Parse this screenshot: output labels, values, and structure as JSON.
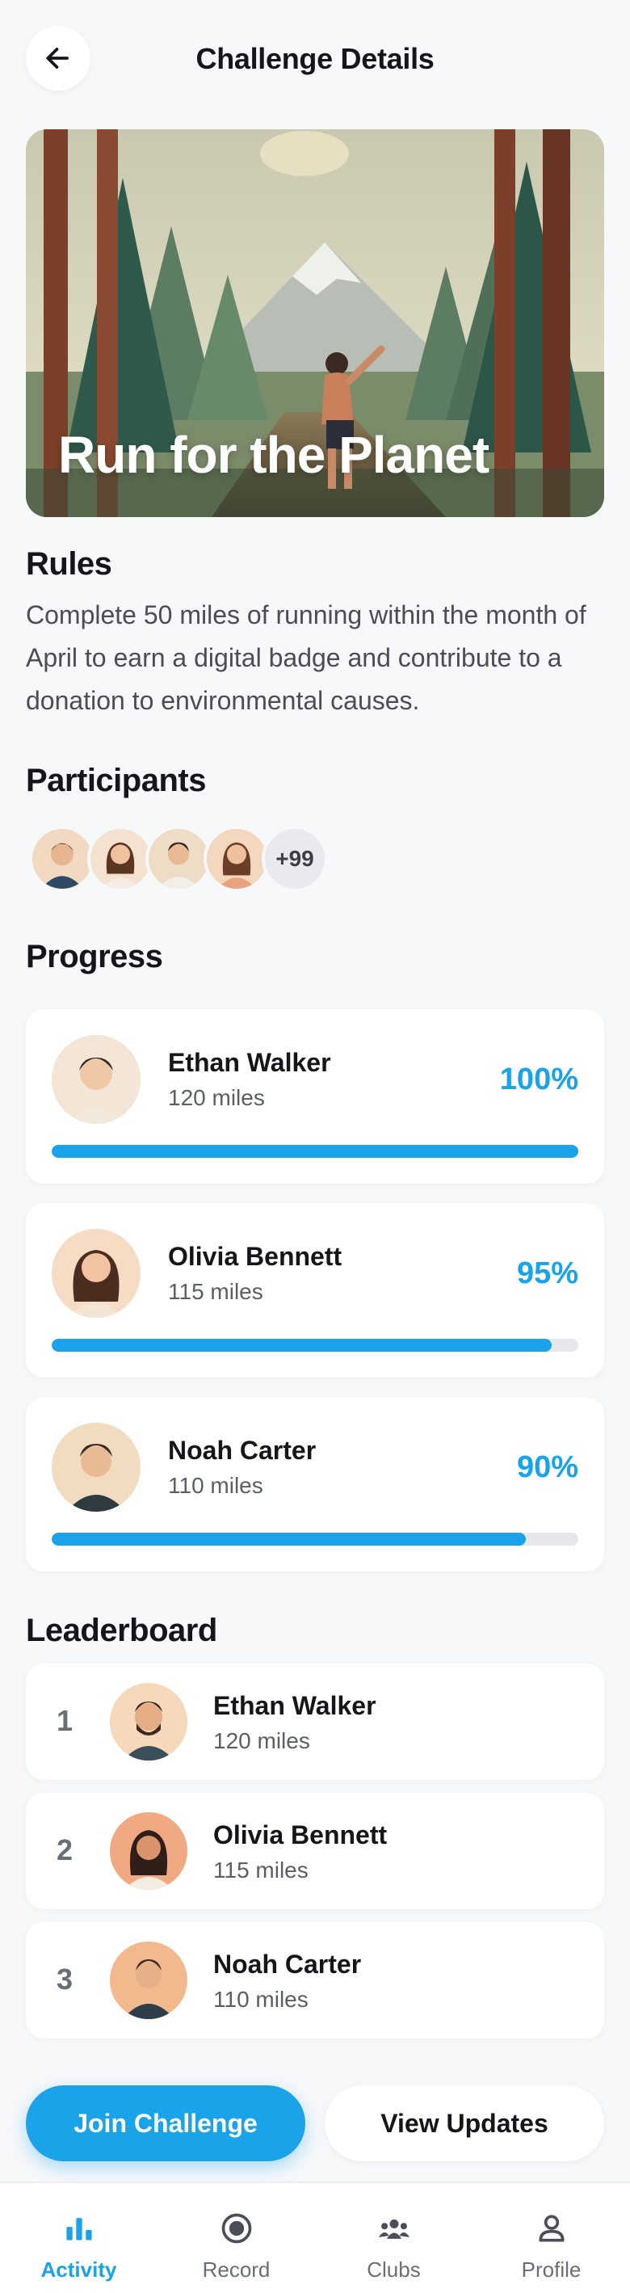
{
  "header": {
    "title": "Challenge Details"
  },
  "hero": {
    "title": "Run for the Planet"
  },
  "rules": {
    "heading": "Rules",
    "text": "Complete 50 miles of running within the month of April to earn a digital badge and contribute to a donation to environmental causes."
  },
  "participants": {
    "heading": "Participants",
    "more_label": "+99"
  },
  "progress": {
    "heading": "Progress",
    "entries": [
      {
        "name": "Ethan Walker",
        "miles": "120 miles",
        "percent_label": "100%",
        "fraction": 1.0
      },
      {
        "name": "Olivia Bennett",
        "miles": "115 miles",
        "percent_label": "95%",
        "fraction": 0.95
      },
      {
        "name": "Noah Carter",
        "miles": "110 miles",
        "percent_label": "90%",
        "fraction": 0.9
      }
    ]
  },
  "leaderboard": {
    "heading": "Leaderboard",
    "entries": [
      {
        "rank": "1",
        "name": "Ethan Walker",
        "miles": "120 miles"
      },
      {
        "rank": "2",
        "name": "Olivia Bennett",
        "miles": "115 miles"
      },
      {
        "rank": "3",
        "name": "Noah Carter",
        "miles": "110 miles"
      }
    ]
  },
  "actions": {
    "join_label": "Join Challenge",
    "updates_label": "View Updates"
  },
  "tabbar": {
    "items": [
      {
        "label": "Activity",
        "icon": "bar-chart-icon"
      },
      {
        "label": "Record",
        "icon": "record-icon"
      },
      {
        "label": "Clubs",
        "icon": "group-icon"
      },
      {
        "label": "Profile",
        "icon": "person-icon"
      }
    ],
    "active": "Activity"
  },
  "colors": {
    "accent": "#1aa3e8",
    "background": "#f7f8fa",
    "track": "#e6e7ea"
  }
}
